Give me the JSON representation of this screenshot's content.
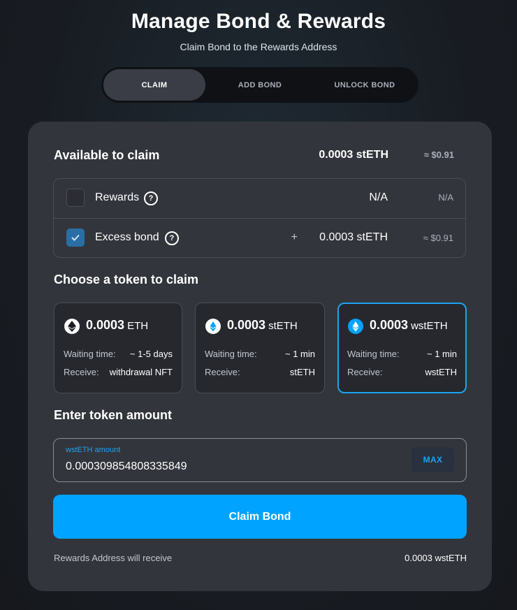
{
  "header": {
    "title": "Manage Bond & Rewards",
    "subtitle": "Claim Bond to the Rewards Address"
  },
  "tabs": [
    {
      "label": "CLAIM",
      "active": true
    },
    {
      "label": "ADD BOND",
      "active": false
    },
    {
      "label": "UNLOCK BOND",
      "active": false
    }
  ],
  "available": {
    "title": "Available to claim",
    "amount": "0.0003 stETH",
    "usd": "≈ $0.91"
  },
  "claim_rows": [
    {
      "label": "Rewards",
      "help_icon": "?",
      "checked": false,
      "value": "N/A",
      "usd": "N/A",
      "prefix": ""
    },
    {
      "label": "Excess bond",
      "help_icon": "?",
      "checked": true,
      "value": "0.0003 stETH",
      "usd": "≈ $0.91",
      "prefix": "+"
    }
  ],
  "token_section": {
    "title": "Choose a token to claim",
    "waiting_label": "Waiting time:",
    "receive_label": "Receive:"
  },
  "tokens": [
    {
      "amount": "0.0003",
      "unit": "ETH",
      "icon": "eth-icon",
      "waiting": "~ 1-5 days",
      "receive": "withdrawal NFT",
      "selected": false
    },
    {
      "amount": "0.0003",
      "unit": "stETH",
      "icon": "steth-icon",
      "waiting": "~ 1 min",
      "receive": "stETH",
      "selected": false
    },
    {
      "amount": "0.0003",
      "unit": "wstETH",
      "icon": "wsteth-icon",
      "waiting": "~ 1 min",
      "receive": "wstETH",
      "selected": true
    }
  ],
  "amount_section": {
    "title": "Enter token amount",
    "input_label": "wstETH amount",
    "input_value": "0.000309854808335849",
    "max_label": "MAX"
  },
  "submit": {
    "label": "Claim Bond"
  },
  "footer": {
    "left": "Rewards Address will receive",
    "right": "0.0003 wstETH"
  },
  "colors": {
    "accent": "#00a3ff",
    "card": "#33353c",
    "checkbox_checked": "#2a6ea6"
  }
}
